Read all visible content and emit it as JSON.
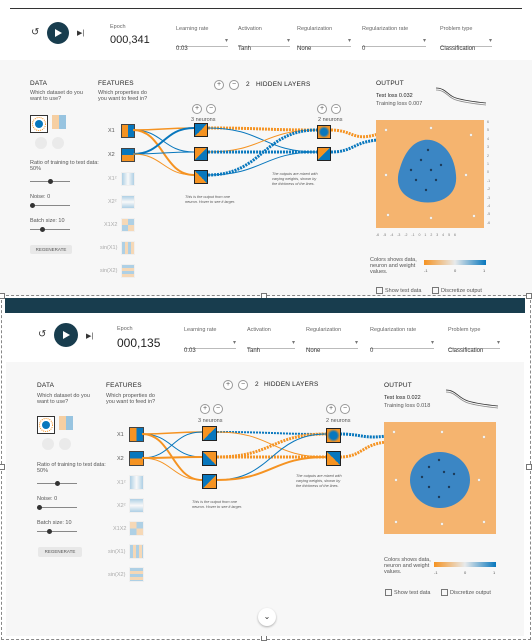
{
  "top": {
    "epoch_label": "Epoch",
    "epoch_value": "000,341",
    "learning_rate_label": "Learning rate",
    "learning_rate_value": "0.03",
    "activation_label": "Activation",
    "activation_value": "Tanh",
    "regularization_label": "Regularization",
    "regularization_value": "None",
    "regularization_rate_label": "Regularization rate",
    "regularization_rate_value": "0",
    "problem_type_label": "Problem type",
    "problem_type_value": "Classification",
    "data_title": "DATA",
    "data_sub": "Which dataset do you want to use?",
    "ratio_label": "Ratio of training to test data:  50%",
    "noise_label": "Noise:  0",
    "batch_label": "Batch size:  10",
    "regenerate": "REGENERATE",
    "features_title": "FEATURES",
    "features_sub": "Which properties do you want to feed in?",
    "hidden_count": "2",
    "hidden_label": "HIDDEN LAYERS",
    "layer1_neurons": "3 neurons",
    "layer2_neurons": "2 neurons",
    "note1": "This is the output from one neuron. Hover to see it larger.",
    "note2": "The outputs are mixed with varying weights, shown by the thickness of the lines.",
    "output_title": "OUTPUT",
    "test_loss": "Test loss 0.032",
    "training_loss": "Training loss 0.007",
    "colors_note": "Colors shows data, neuron and weight values.",
    "scale_min": "-1",
    "scale_mid": "0",
    "scale_max": "1",
    "show_test": "Show test data",
    "discretize": "Discretize output",
    "features": [
      "X1",
      "X2",
      "X1²",
      "X2²",
      "X1X2",
      "sin(X1)",
      "sin(X2)"
    ],
    "axis_ticks": [
      "-6",
      "-5",
      "-4",
      "-3",
      "-2",
      "-1",
      "0",
      "1",
      "2",
      "3",
      "4",
      "5",
      "6"
    ]
  },
  "bottom": {
    "epoch_label": "Epoch",
    "epoch_value": "000,135",
    "learning_rate_label": "Learning rate",
    "learning_rate_value": "0.03",
    "activation_label": "Activation",
    "activation_value": "Tanh",
    "regularization_label": "Regularization",
    "regularization_value": "None",
    "regularization_rate_label": "Regularization rate",
    "regularization_rate_value": "0",
    "problem_type_label": "Problem type",
    "problem_type_value": "Classification",
    "data_title": "DATA",
    "data_sub": "Which dataset do you want to use?",
    "ratio_label": "Ratio of training to test data:  50%",
    "noise_label": "Noise:  0",
    "batch_label": "Batch size:  10",
    "regenerate": "REGENERATE",
    "features_title": "FEATURES",
    "features_sub": "Which properties do you want to feed in?",
    "hidden_count": "2",
    "hidden_label": "HIDDEN LAYERS",
    "layer1_neurons": "3 neurons",
    "layer2_neurons": "2 neurons",
    "note1": "This is the output from one neuron. Hover to see it larger.",
    "note2": "The outputs are mixed with varying weights, shown by the thickness of the lines.",
    "output_title": "OUTPUT",
    "test_loss": "Test loss 0.022",
    "training_loss": "Training loss 0.018",
    "colors_note": "Colors shows data, neuron and weight values.",
    "scale_min": "-1",
    "scale_mid": "0",
    "scale_max": "1",
    "show_test": "Show test data",
    "discretize": "Discretize output",
    "features": [
      "X1",
      "X2",
      "X1²",
      "X2²",
      "X1X2",
      "sin(X1)",
      "sin(X2)"
    ]
  },
  "colors": {
    "orange": "#f59322",
    "blue": "#0877bd",
    "dark": "#183d4e"
  },
  "scroll_icon": "chevron-down-icon"
}
